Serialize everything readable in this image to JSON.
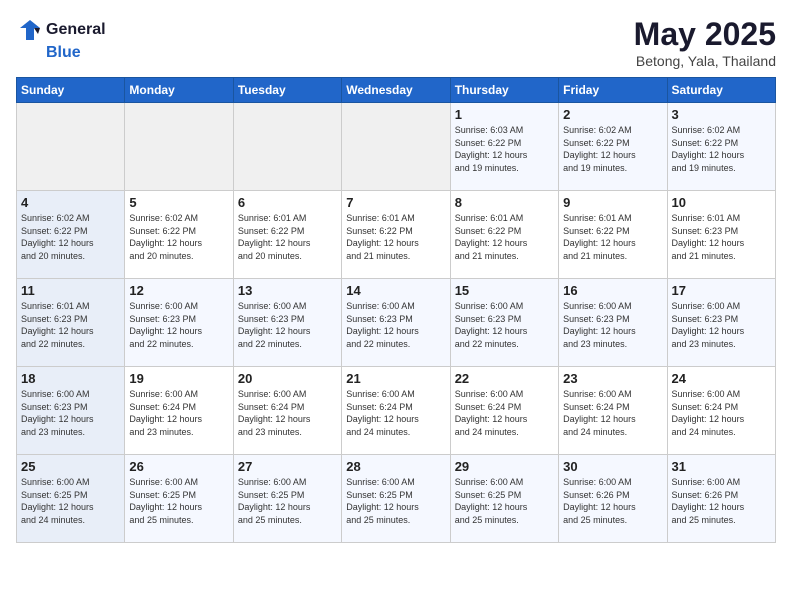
{
  "header": {
    "logo_general": "General",
    "logo_blue": "Blue",
    "month_year": "May 2025",
    "location": "Betong, Yala, Thailand"
  },
  "days_of_week": [
    "Sunday",
    "Monday",
    "Tuesday",
    "Wednesday",
    "Thursday",
    "Friday",
    "Saturday"
  ],
  "weeks": [
    [
      {
        "day": "",
        "info": ""
      },
      {
        "day": "",
        "info": ""
      },
      {
        "day": "",
        "info": ""
      },
      {
        "day": "",
        "info": ""
      },
      {
        "day": "1",
        "info": "Sunrise: 6:03 AM\nSunset: 6:22 PM\nDaylight: 12 hours\nand 19 minutes."
      },
      {
        "day": "2",
        "info": "Sunrise: 6:02 AM\nSunset: 6:22 PM\nDaylight: 12 hours\nand 19 minutes."
      },
      {
        "day": "3",
        "info": "Sunrise: 6:02 AM\nSunset: 6:22 PM\nDaylight: 12 hours\nand 19 minutes."
      }
    ],
    [
      {
        "day": "4",
        "info": "Sunrise: 6:02 AM\nSunset: 6:22 PM\nDaylight: 12 hours\nand 20 minutes."
      },
      {
        "day": "5",
        "info": "Sunrise: 6:02 AM\nSunset: 6:22 PM\nDaylight: 12 hours\nand 20 minutes."
      },
      {
        "day": "6",
        "info": "Sunrise: 6:01 AM\nSunset: 6:22 PM\nDaylight: 12 hours\nand 20 minutes."
      },
      {
        "day": "7",
        "info": "Sunrise: 6:01 AM\nSunset: 6:22 PM\nDaylight: 12 hours\nand 21 minutes."
      },
      {
        "day": "8",
        "info": "Sunrise: 6:01 AM\nSunset: 6:22 PM\nDaylight: 12 hours\nand 21 minutes."
      },
      {
        "day": "9",
        "info": "Sunrise: 6:01 AM\nSunset: 6:22 PM\nDaylight: 12 hours\nand 21 minutes."
      },
      {
        "day": "10",
        "info": "Sunrise: 6:01 AM\nSunset: 6:23 PM\nDaylight: 12 hours\nand 21 minutes."
      }
    ],
    [
      {
        "day": "11",
        "info": "Sunrise: 6:01 AM\nSunset: 6:23 PM\nDaylight: 12 hours\nand 22 minutes."
      },
      {
        "day": "12",
        "info": "Sunrise: 6:00 AM\nSunset: 6:23 PM\nDaylight: 12 hours\nand 22 minutes."
      },
      {
        "day": "13",
        "info": "Sunrise: 6:00 AM\nSunset: 6:23 PM\nDaylight: 12 hours\nand 22 minutes."
      },
      {
        "day": "14",
        "info": "Sunrise: 6:00 AM\nSunset: 6:23 PM\nDaylight: 12 hours\nand 22 minutes."
      },
      {
        "day": "15",
        "info": "Sunrise: 6:00 AM\nSunset: 6:23 PM\nDaylight: 12 hours\nand 22 minutes."
      },
      {
        "day": "16",
        "info": "Sunrise: 6:00 AM\nSunset: 6:23 PM\nDaylight: 12 hours\nand 23 minutes."
      },
      {
        "day": "17",
        "info": "Sunrise: 6:00 AM\nSunset: 6:23 PM\nDaylight: 12 hours\nand 23 minutes."
      }
    ],
    [
      {
        "day": "18",
        "info": "Sunrise: 6:00 AM\nSunset: 6:23 PM\nDaylight: 12 hours\nand 23 minutes."
      },
      {
        "day": "19",
        "info": "Sunrise: 6:00 AM\nSunset: 6:24 PM\nDaylight: 12 hours\nand 23 minutes."
      },
      {
        "day": "20",
        "info": "Sunrise: 6:00 AM\nSunset: 6:24 PM\nDaylight: 12 hours\nand 23 minutes."
      },
      {
        "day": "21",
        "info": "Sunrise: 6:00 AM\nSunset: 6:24 PM\nDaylight: 12 hours\nand 24 minutes."
      },
      {
        "day": "22",
        "info": "Sunrise: 6:00 AM\nSunset: 6:24 PM\nDaylight: 12 hours\nand 24 minutes."
      },
      {
        "day": "23",
        "info": "Sunrise: 6:00 AM\nSunset: 6:24 PM\nDaylight: 12 hours\nand 24 minutes."
      },
      {
        "day": "24",
        "info": "Sunrise: 6:00 AM\nSunset: 6:24 PM\nDaylight: 12 hours\nand 24 minutes."
      }
    ],
    [
      {
        "day": "25",
        "info": "Sunrise: 6:00 AM\nSunset: 6:25 PM\nDaylight: 12 hours\nand 24 minutes."
      },
      {
        "day": "26",
        "info": "Sunrise: 6:00 AM\nSunset: 6:25 PM\nDaylight: 12 hours\nand 25 minutes."
      },
      {
        "day": "27",
        "info": "Sunrise: 6:00 AM\nSunset: 6:25 PM\nDaylight: 12 hours\nand 25 minutes."
      },
      {
        "day": "28",
        "info": "Sunrise: 6:00 AM\nSunset: 6:25 PM\nDaylight: 12 hours\nand 25 minutes."
      },
      {
        "day": "29",
        "info": "Sunrise: 6:00 AM\nSunset: 6:25 PM\nDaylight: 12 hours\nand 25 minutes."
      },
      {
        "day": "30",
        "info": "Sunrise: 6:00 AM\nSunset: 6:26 PM\nDaylight: 12 hours\nand 25 minutes."
      },
      {
        "day": "31",
        "info": "Sunrise: 6:00 AM\nSunset: 6:26 PM\nDaylight: 12 hours\nand 25 minutes."
      }
    ]
  ]
}
